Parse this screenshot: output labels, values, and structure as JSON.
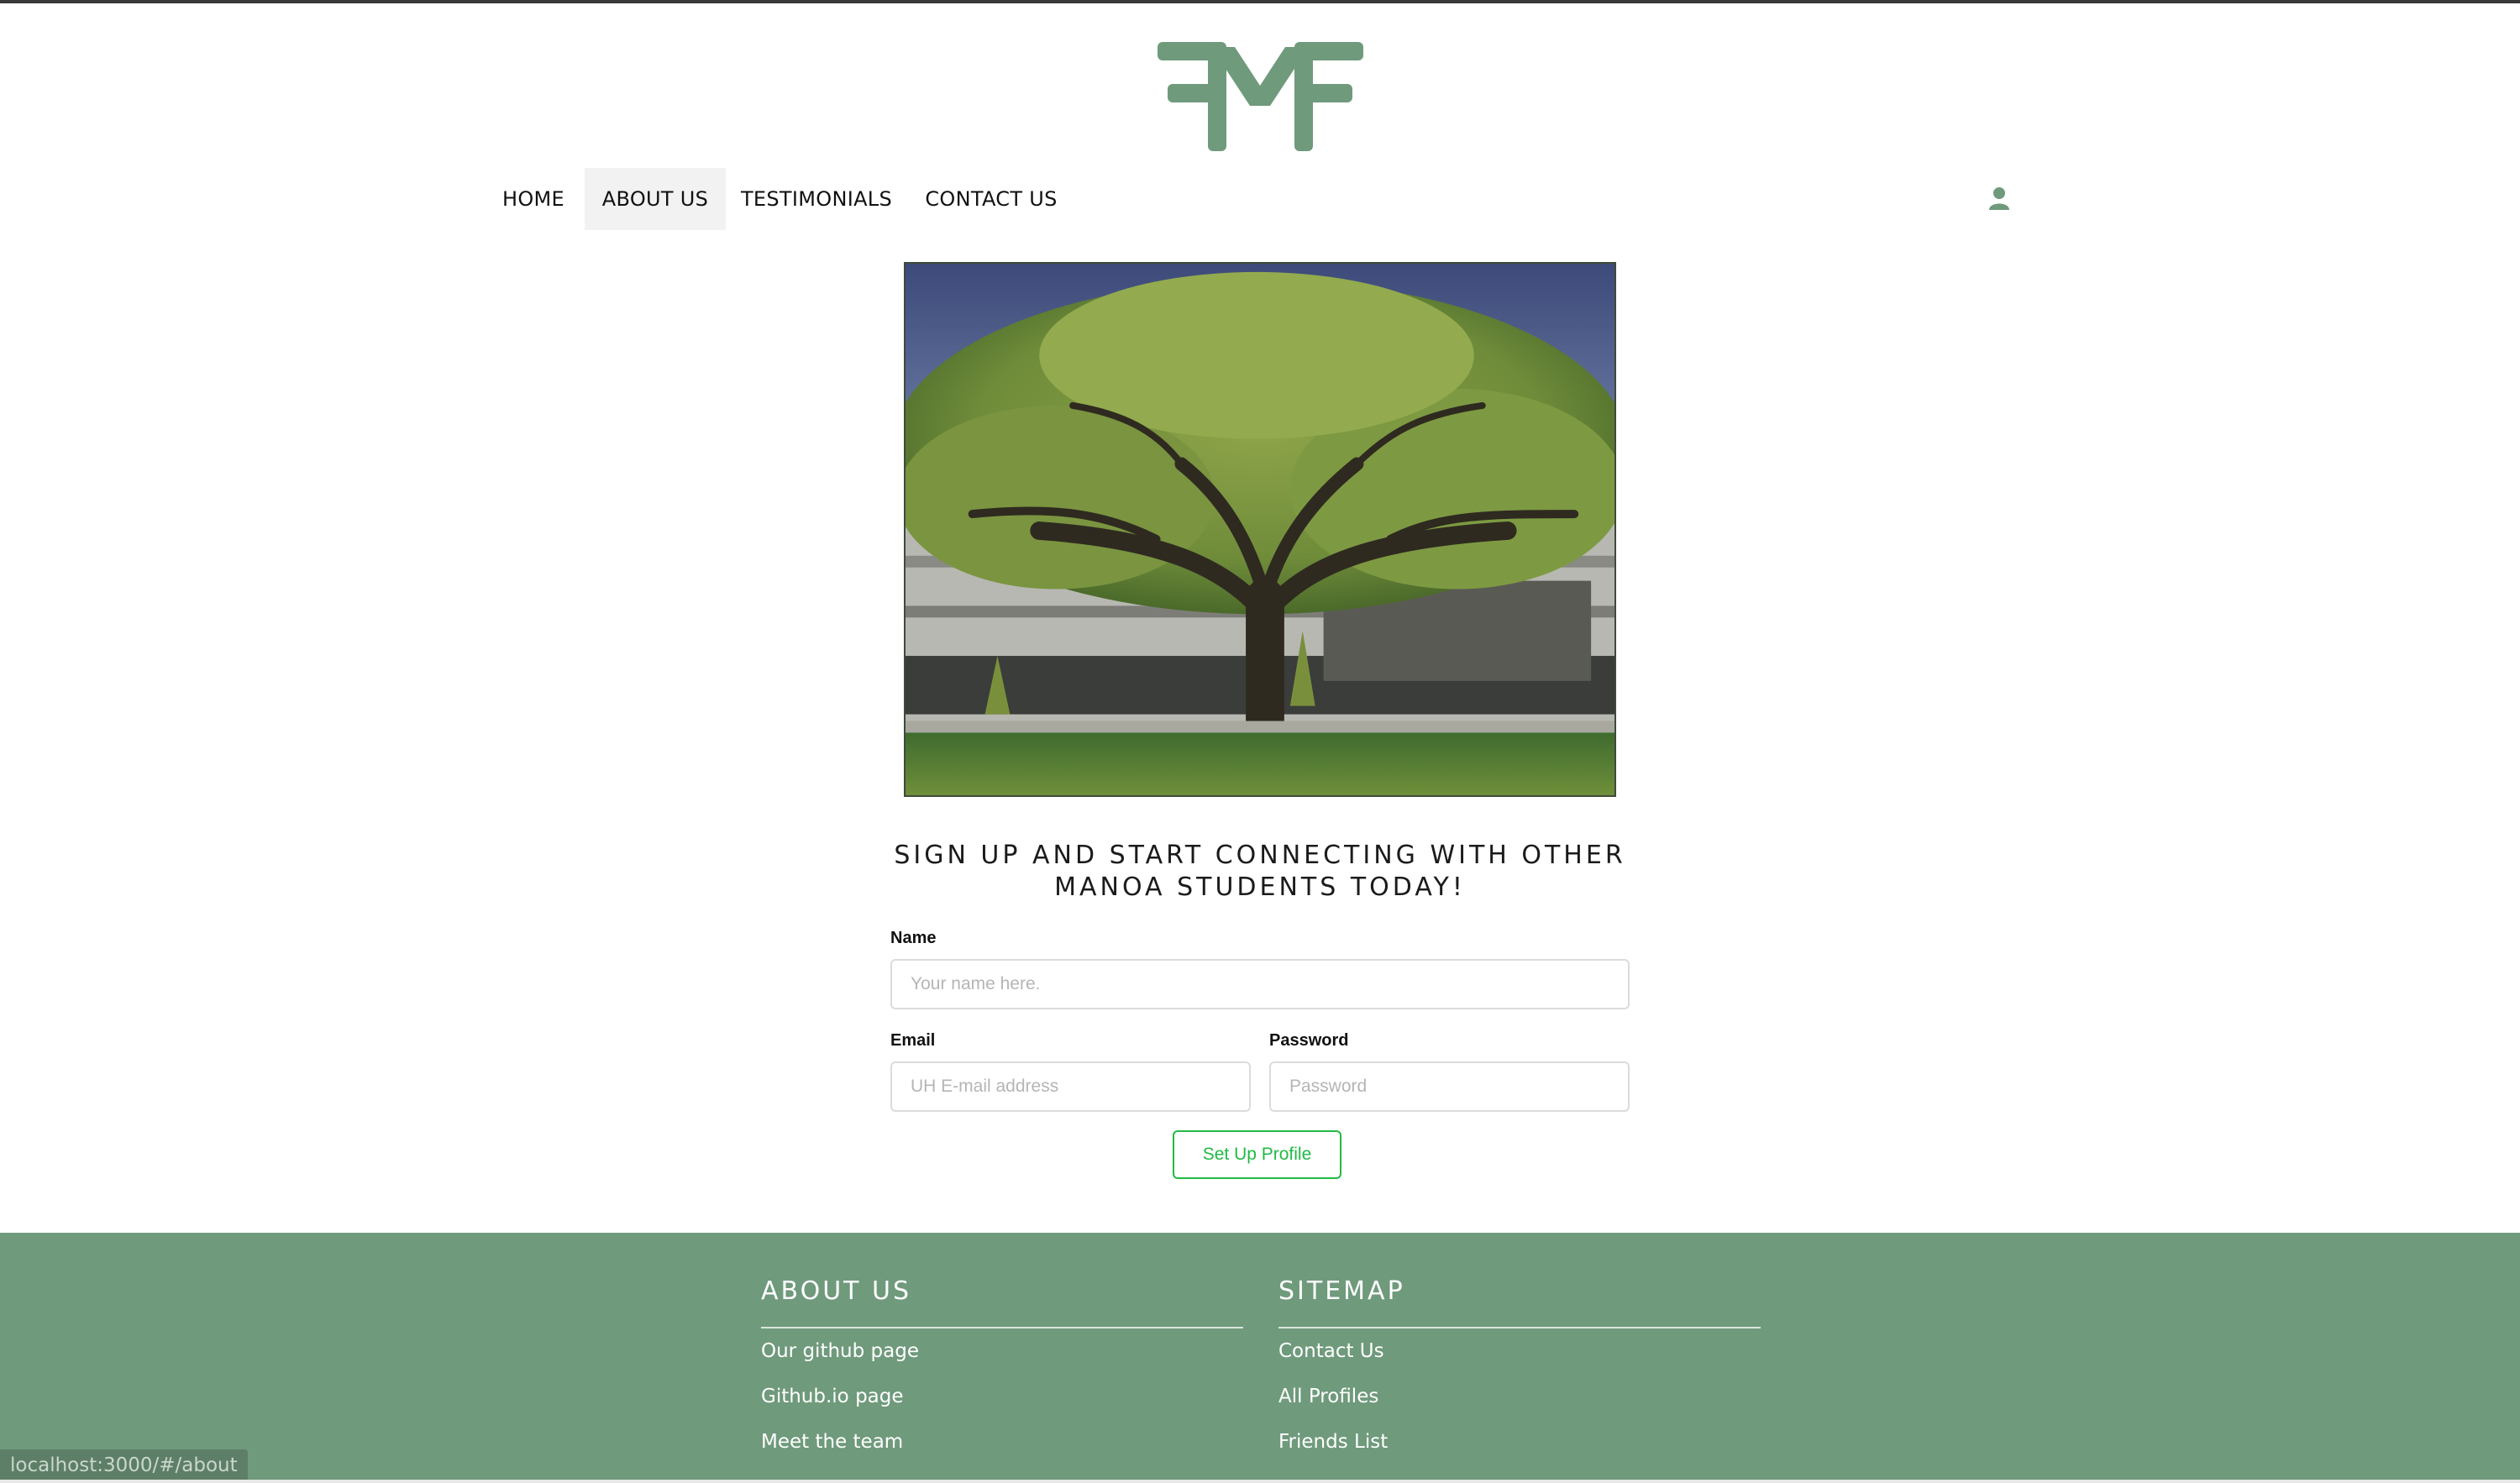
{
  "brand": {
    "logo_alt": "FMF",
    "color": "#6f9a7c"
  },
  "nav": {
    "items": [
      {
        "label": "HOME"
      },
      {
        "label": "ABOUT US",
        "active": true
      },
      {
        "label": "TESTIMONIALS"
      },
      {
        "label": "CONTACT US"
      }
    ],
    "user_icon": "user-icon"
  },
  "hero": {
    "image": "tree-photo"
  },
  "signup": {
    "heading_line1": "SIGN UP AND START CONNECTING WITH OTHER",
    "heading_line2": "MANOA STUDENTS TODAY!",
    "name_label": "Name",
    "name_placeholder": "Your name here.",
    "email_label": "Email",
    "email_placeholder": "UH E-mail address",
    "password_label": "Password",
    "password_placeholder": "Password",
    "submit_label": "Set Up Profile",
    "accent": "#21ba45"
  },
  "footer": {
    "about": {
      "heading": "ABOUT US",
      "links": [
        "Our github page",
        "Github.io page",
        "Meet the team"
      ]
    },
    "sitemap": {
      "heading": "SITEMAP",
      "links": [
        "Contact Us",
        "All Profiles",
        "Friends List"
      ]
    }
  },
  "status_bar": {
    "url": "localhost:3000/#/about"
  }
}
